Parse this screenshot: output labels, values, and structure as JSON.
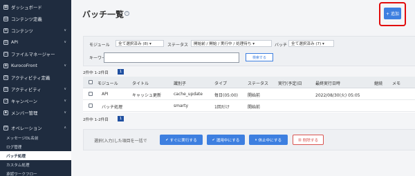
{
  "sidebar": {
    "items": [
      {
        "label": "ダッシュボード",
        "icon": "dashboard-icon",
        "glyph": "▦",
        "chevron": ""
      },
      {
        "label": "コンテンツ定義",
        "icon": "content-definition-icon",
        "glyph": "▤",
        "chevron": ""
      },
      {
        "label": "コンテンツ",
        "icon": "content-icon",
        "glyph": "≡",
        "chevron": "∨"
      },
      {
        "label": "API",
        "icon": "api-icon",
        "glyph": "◎",
        "chevron": "∨"
      },
      {
        "label": "ファイルマネージャー",
        "icon": "file-manager-icon",
        "glyph": "▭",
        "chevron": ""
      },
      {
        "label": "KurocoFront",
        "icon": "kurocofront-icon",
        "glyph": "◈",
        "chevron": "∨"
      },
      {
        "label": "アクティビティ定義",
        "icon": "activity-definition-icon",
        "glyph": "◷",
        "chevron": ""
      },
      {
        "label": "アクティビティ",
        "icon": "activity-icon",
        "glyph": "◷",
        "chevron": "∨"
      },
      {
        "label": "キャンペーン",
        "icon": "campaign-icon",
        "glyph": "◁",
        "chevron": "∨"
      },
      {
        "label": "メンバー管理",
        "icon": "member-icon",
        "glyph": "♟",
        "chevron": "∨"
      },
      {
        "label": "オペレーション",
        "icon": "operation-icon",
        "glyph": "⟳",
        "chevron": "∧"
      }
    ],
    "subitems": [
      {
        "label": "メッセージDL名前"
      },
      {
        "label": "ログ管理"
      },
      {
        "label": "バッチ処理"
      },
      {
        "label": "カスタム処理"
      },
      {
        "label": "承認ワークフロー"
      }
    ]
  },
  "header": {
    "title": "バッチ一覧",
    "help_glyph": "?",
    "add_label": "+ 追加"
  },
  "filter": {
    "module_label": "モジュール",
    "module_value": "全て選択済み (8) ▾",
    "status_label": "ステータス",
    "status_value": "開始前 / 開始 / 実行中 / 処理待ち ▾",
    "batch_label": "バッチ",
    "batch_value": "全て選択済み (7) ▾",
    "keyword_label": "キーワード",
    "keyword_value": "",
    "search_label": "検索する"
  },
  "pagination": {
    "count_text": "2件中 1-2件目",
    "page": "1"
  },
  "table": {
    "headers": [
      "モジュール",
      "タイトル",
      "識別子",
      "タイプ",
      "ステータス",
      "実行(予定)日",
      "最終実行日時",
      "継続",
      "メモ"
    ],
    "rows": [
      {
        "module": "API",
        "title": "キャッシュ更新",
        "identifier": "cache_update",
        "type": "毎日(05:00)",
        "status": "開始前",
        "scheduled": "",
        "last_run": "2022/08/30(火) 05:05",
        "cont": "",
        "memo": ""
      },
      {
        "module": "バッチ処理",
        "title": "",
        "identifier": "smarty",
        "type": "1回だけ",
        "status": "開始前",
        "scheduled": "",
        "last_run": "",
        "cont": "",
        "memo": ""
      }
    ]
  },
  "bulk": {
    "label": "選択(入力)した項目を一括で",
    "run_now": "すぐに実行する",
    "activate": "運用中にする",
    "suspend": "休止中にする",
    "delete": "削除する"
  },
  "colors": {
    "sidebar_bg": "#1f2c3f",
    "primary": "#3d7fe0",
    "highlight_border": "#e10b0b",
    "danger": "#d9534f"
  }
}
